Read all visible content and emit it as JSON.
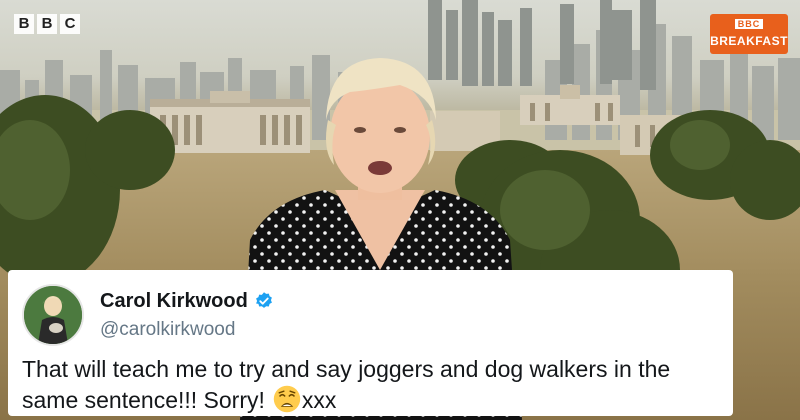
{
  "broadcast": {
    "channel_logo_letters": [
      "B",
      "B",
      "C"
    ],
    "programme_logo": {
      "top": "BBC",
      "bottom": "BREAKFAST"
    },
    "accent_color": "#e8601c"
  },
  "tweet": {
    "display_name": "Carol Kirkwood",
    "handle": "@carolkirkwood",
    "verified": true,
    "text": "That will teach me to try and say joggers and dog walkers in the same sentence!!! Sorry!",
    "emoji": "weary-face",
    "suffix": "xxx"
  }
}
